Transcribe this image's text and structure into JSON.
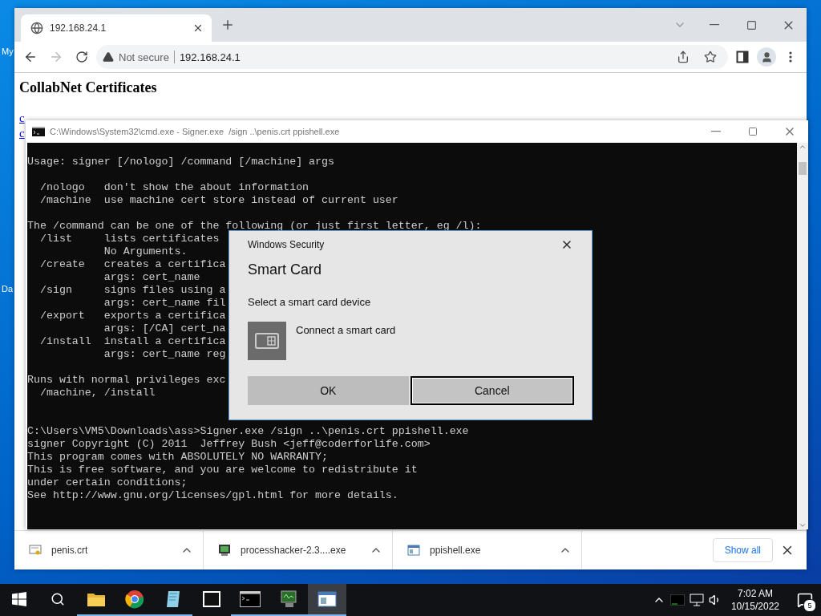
{
  "desktop": {
    "icon_labels": [
      "My",
      "Da"
    ]
  },
  "browser": {
    "tabs": [
      {
        "title": "192.168.24.1",
        "selected": true
      }
    ],
    "address": {
      "security": "Not secure",
      "url": "192.168.24.1"
    },
    "page": {
      "heading": "CollabNet Certificates",
      "links": [
        "c",
        "c"
      ]
    },
    "downloads": [
      {
        "name": "penis.crt",
        "kind": "certificate"
      },
      {
        "name": "processhacker-2.3....exe",
        "kind": "program"
      },
      {
        "name": "ppishell.exe",
        "kind": "window"
      }
    ],
    "show_all": "Show all"
  },
  "console_window": {
    "title": "C:\\Windows\\System32\\cmd.exe - Signer.exe  /sign ..\\penis.crt ppishell.exe",
    "blocks": [
      {
        "kind": "help",
        "lines": [
          "Usage: signer [/nologo] /command [/machine] args"
        ]
      },
      {
        "kind": "help",
        "lines": [
          "  /nologo   don't show the about information",
          "  /machine  use machine cert store instead of current user"
        ]
      },
      {
        "kind": "help",
        "lines": [
          "The /command can be one of the following (or just first letter, eg /l):",
          "  /list     lists certificates",
          "            No Arguments.",
          "  /create   creates a certifica",
          "            args: cert_name",
          "  /sign     signs files using a",
          "            args: cert_name fil",
          "  /export   exports a certifica",
          "            args: [/CA] cert_na",
          "  /install  install a certifica",
          "            args: cert_name reg"
        ]
      },
      {
        "kind": "help",
        "lines": [
          "Runs with normal privileges exc",
          "  /machine, /install"
        ]
      },
      {
        "kind": "session",
        "lines": [
          "C:\\Users\\VM5\\Downloads\\ass>Signer.exe /sign ..\\penis.crt ppishell.exe",
          "signer Copyright (C) 2011  Jeffrey Bush <jeff@coderforlife.com>",
          "This program comes with ABSOLUTELY NO WARRANTY;",
          "This is free software, and you are welcome to redistribute it",
          "under certain conditions;",
          "See http://www.gnu.org/licenses/gpl.html for more details."
        ]
      }
    ]
  },
  "dialog": {
    "caption": "Windows Security",
    "title": "Smart Card",
    "prompt": "Select a smart card device",
    "device": "Connect a smart card",
    "buttons": [
      {
        "label": "OK",
        "focused": false
      },
      {
        "label": "Cancel",
        "focused": true
      }
    ]
  },
  "taskbar": {
    "apps": [
      {
        "kind": "explorer",
        "running": true,
        "active": false
      },
      {
        "kind": "chrome",
        "running": true,
        "active": false
      },
      {
        "kind": "notepad",
        "running": true,
        "active": false
      },
      {
        "kind": "archiver",
        "running": false,
        "active": false
      },
      {
        "kind": "console",
        "running": true,
        "active": false
      },
      {
        "kind": "monitor",
        "running": true,
        "active": false
      },
      {
        "kind": "window",
        "running": true,
        "active": true
      }
    ],
    "time": "7:02 AM",
    "date": "10/15/2022",
    "notifications": "5"
  }
}
